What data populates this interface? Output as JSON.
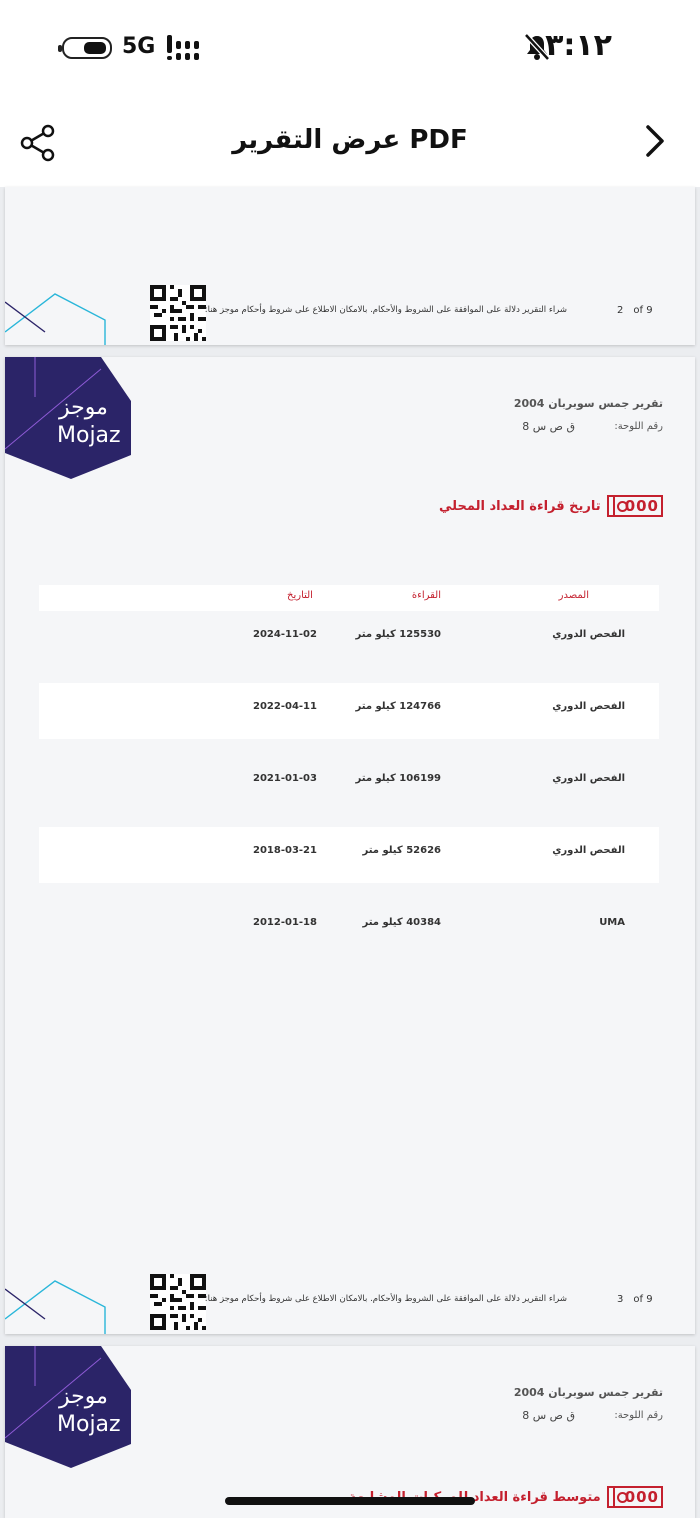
{
  "status_bar": {
    "network": "5G",
    "time": "٣:١٢"
  },
  "header": {
    "title": "عرض التقرير PDF"
  },
  "page_footer": {
    "notice": "شراء التقرير دلالة على الموافقة على الشروط والأحكام. بالامكان الاطلاع على شروط وأحكام موجز هنا:"
  },
  "pages": {
    "prev": {
      "page": "2",
      "of": "of 9"
    },
    "current": {
      "page": "3",
      "of": "of 9"
    }
  },
  "logo": {
    "arabic": "موجز",
    "english": "Mojaz"
  },
  "report": {
    "title": "تقرير جمس سوبربان 2004",
    "plate_label": "رقم اللوحة:",
    "plate_value": "ق ص س 8"
  },
  "odometer_section": {
    "digits": "000",
    "title": "تاريخ قراءة العداد المحلي",
    "columns": {
      "source": "المصدر",
      "reading": "القراءة",
      "date": "التاريخ"
    },
    "rows": [
      {
        "source": "الفحص الدوري",
        "reading": "125530 كيلو متر",
        "date": "2024-11-02"
      },
      {
        "source": "الفحص الدوري",
        "reading": "124766 كيلو متر",
        "date": "2022-04-11"
      },
      {
        "source": "الفحص الدوري",
        "reading": "106199 كيلو متر",
        "date": "2021-01-03"
      },
      {
        "source": "الفحص الدوري",
        "reading": "52626 كيلو متر",
        "date": "2018-03-21"
      },
      {
        "source": "UMA",
        "reading": "40384 كيلو متر",
        "date": "2012-01-18"
      }
    ]
  },
  "next_section": {
    "digits": "000",
    "title": "متوسط قراءة العداد للمركبات المشابهة"
  },
  "colors": {
    "accent": "#c4202e",
    "logo_bg": "#2b2468"
  }
}
